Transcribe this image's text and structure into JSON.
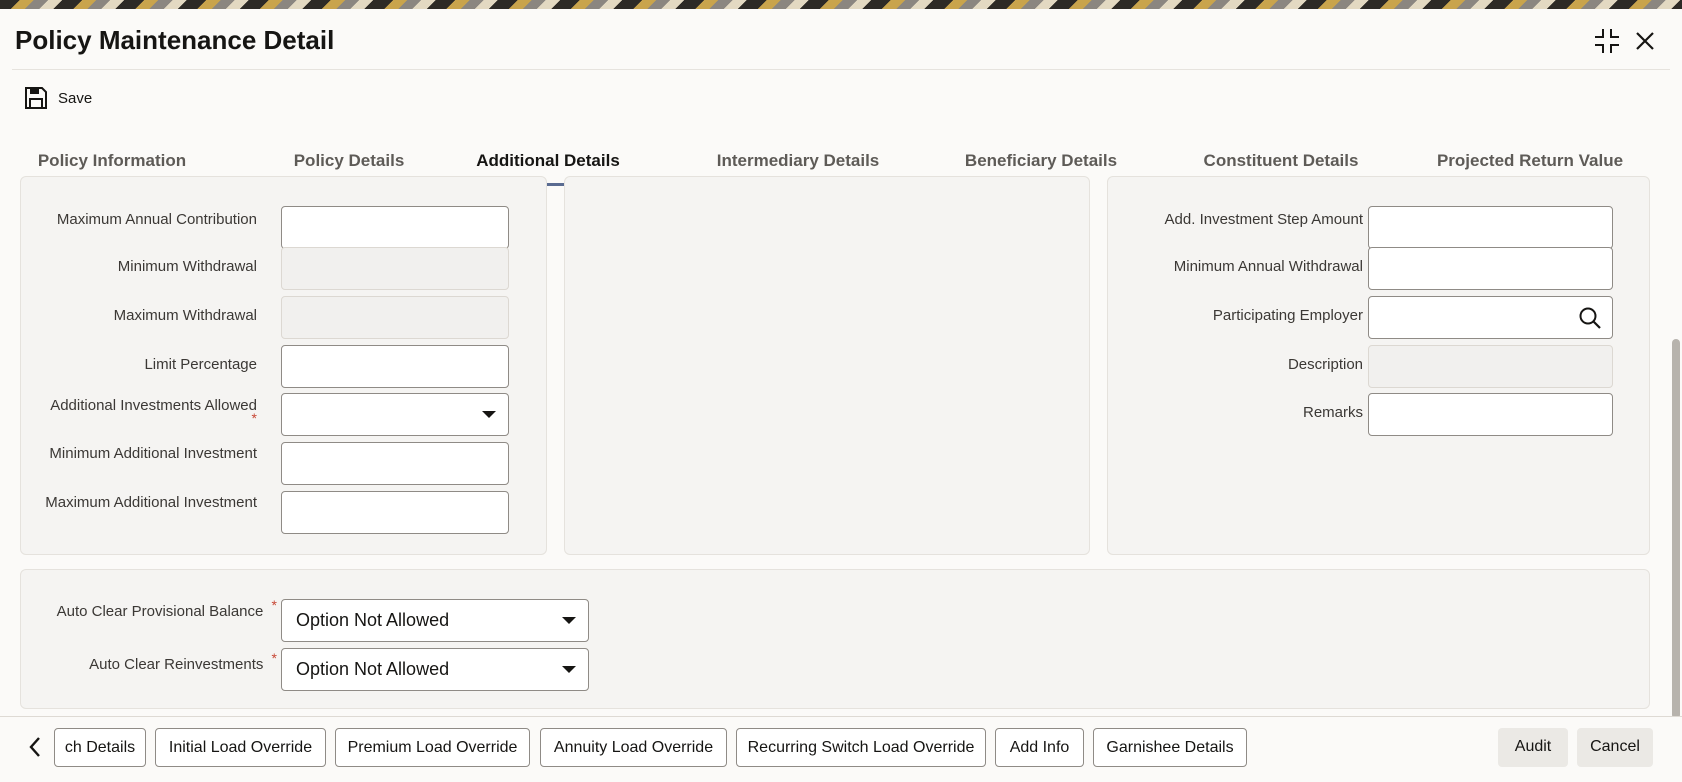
{
  "window": {
    "title": "Policy Maintenance Detail"
  },
  "toolbar": {
    "save_label": "Save"
  },
  "tabs": [
    {
      "label": "Policy Information"
    },
    {
      "label": "Policy Details"
    },
    {
      "label": "Additional Details"
    },
    {
      "label": "Intermediary Details"
    },
    {
      "label": "Beneficiary Details"
    },
    {
      "label": "Constituent Details"
    },
    {
      "label": "Projected Return Value"
    }
  ],
  "active_tab": "Additional Details",
  "left_panel": {
    "max_annual_contribution": {
      "label": "Maximum Annual Contribution",
      "value": ""
    },
    "min_withdrawal": {
      "label": "Minimum Withdrawal",
      "value": ""
    },
    "max_withdrawal": {
      "label": "Maximum Withdrawal",
      "value": ""
    },
    "limit_percentage": {
      "label": "Limit Percentage",
      "value": ""
    },
    "additional_investments_allowed": {
      "label": "Additional Investments Allowed",
      "value": ""
    },
    "min_additional_investment": {
      "label": "Minimum Additional Investment",
      "value": ""
    },
    "max_additional_investment": {
      "label": "Maximum Additional Investment",
      "value": ""
    }
  },
  "right_panel": {
    "add_investment_step_amount": {
      "label": "Add. Investment Step Amount",
      "value": ""
    },
    "min_annual_withdrawal": {
      "label": "Minimum Annual Withdrawal",
      "value": ""
    },
    "participating_employer": {
      "label": "Participating Employer",
      "value": ""
    },
    "description": {
      "label": "Description",
      "value": ""
    },
    "remarks": {
      "label": "Remarks",
      "value": ""
    }
  },
  "bottom_panel": {
    "auto_clear_provisional_balance": {
      "label": "Auto Clear Provisional Balance",
      "value": "Option Not Allowed"
    },
    "auto_clear_reinvestments": {
      "label": "Auto Clear Reinvestments",
      "value": "Option Not Allowed"
    }
  },
  "required_marker": "*",
  "footer": {
    "buttons": [
      "ch Details",
      "Initial Load Override",
      "Premium Load Override",
      "Annuity Load Override",
      "Recurring Switch Load Override",
      "Add Info",
      "Garnishee Details"
    ],
    "audit_label": "Audit",
    "cancel_label": "Cancel"
  },
  "icons": {
    "save": "save-icon",
    "maximize": "maximize-icon",
    "close": "close-icon",
    "search": "search-icon",
    "previous": "chevron-left-icon",
    "dropdown": "caret-down-icon"
  },
  "colors": {
    "active_tab_underline": "#5a6b91",
    "required": "#c74634",
    "panel_background": "#f5f4f2"
  }
}
